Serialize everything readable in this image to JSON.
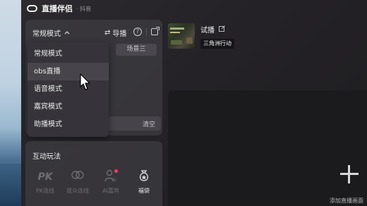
{
  "titlebar": {
    "app_name": "直播伴侣",
    "platform": "· 抖音"
  },
  "left_panel": {
    "mode_label": "常规模式",
    "guide_label": "导播",
    "help_glyph": "?",
    "scene_tab": "场景三",
    "clear_label": "清空"
  },
  "dropdown": {
    "items": [
      "常规模式",
      "obs直播",
      "语音模式",
      "嘉宾模式",
      "助播模式"
    ],
    "hovered_index": 1
  },
  "interact": {
    "title": "互动玩法",
    "tools": [
      {
        "label": "PK连线",
        "icon": "pk-icon"
      },
      {
        "label": "观众连线",
        "icon": "audience-link-icon"
      },
      {
        "label": "AI嘉宾",
        "icon": "ai-guest-icon"
      },
      {
        "label": "福袋",
        "icon": "lucky-bag-icon"
      }
    ]
  },
  "stream": {
    "title": "试播",
    "game_tag": "三角洲行动"
  },
  "preview": {
    "add_label": "添加直播画面"
  },
  "colors": {
    "background": "#242226",
    "panel": "#3e3c42",
    "dropdown": "#36343a",
    "notification_dot": "#ff3b5c"
  }
}
